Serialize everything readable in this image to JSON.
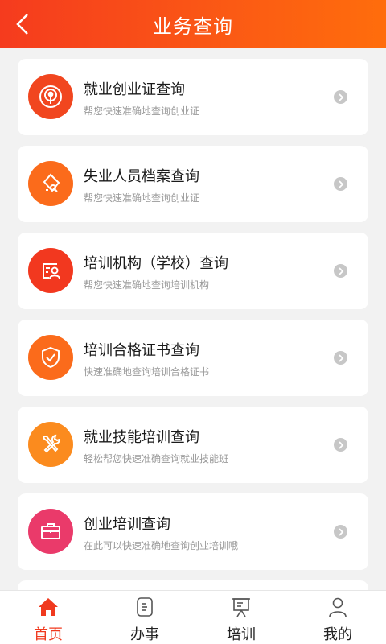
{
  "header": {
    "title": "业务查询"
  },
  "cards": [
    {
      "title": "就业创业证查询",
      "subtitle": "帮您快速准确地查询创业证",
      "icon": "podcast-icon",
      "color": "#f1461f"
    },
    {
      "title": "失业人员档案查询",
      "subtitle": "帮您快速准确地查询创业证",
      "icon": "file-search-icon",
      "color": "#fb6b1b"
    },
    {
      "title": "培训机构（学校）查询",
      "subtitle": "帮您快速准确地查询培训机构",
      "icon": "id-card-icon",
      "color": "#f2381f"
    },
    {
      "title": "培训合格证书查询",
      "subtitle": "快速准确地查询培训合格证书",
      "icon": "shield-check-icon",
      "color": "#fb6b1b"
    },
    {
      "title": "就业技能培训查询",
      "subtitle": "轻松帮您快速准确查询就业技能班",
      "icon": "tools-icon",
      "color": "#fb8b1e"
    },
    {
      "title": "创业培训查询",
      "subtitle": "在此可以快速准确地查询创业培训哦",
      "icon": "briefcase-icon",
      "color": "#ea3a6a"
    }
  ],
  "tabs": [
    {
      "label": "首页",
      "icon": "home-icon",
      "active": true
    },
    {
      "label": "办事",
      "icon": "document-icon",
      "active": false
    },
    {
      "label": "培训",
      "icon": "presentation-icon",
      "active": false
    },
    {
      "label": "我的",
      "icon": "user-icon",
      "active": false
    }
  ],
  "colors": {
    "accent": "#f0391e",
    "header_start": "#f53b1e",
    "header_end": "#ff6d0c"
  }
}
